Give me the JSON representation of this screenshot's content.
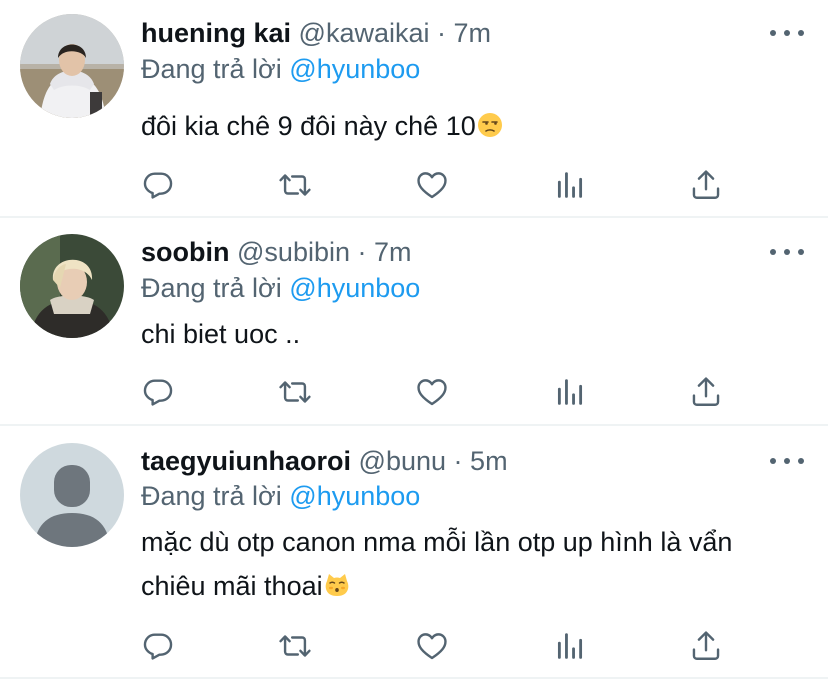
{
  "tweets": [
    {
      "name": "huening kai",
      "handle": "@kawaikai",
      "dot": "·",
      "time": "7m",
      "reply_prefix": "Đang trả lời",
      "reply_to": "@hyunboo",
      "text_lines": [
        "đôi kia chê 9 đôi này chê 10"
      ],
      "emoji": "unamused-face-icon",
      "avatar": "photo-avatar-hoodie"
    },
    {
      "name": "soobin",
      "handle": "@subibin",
      "dot": "·",
      "time": "7m",
      "reply_prefix": "Đang trả lời",
      "reply_to": "@hyunboo",
      "text_lines": [
        "chi biet uoc .."
      ],
      "avatar": "photo-avatar-blond"
    },
    {
      "name": "taegyuiunhaoroi",
      "handle": "@bunu",
      "dot": "·",
      "time": "5m",
      "reply_prefix": "Đang trả lời",
      "reply_to": "@hyunboo",
      "text_lines": [
        "mặc dù otp canon nma mỗi lần otp up hình là vẩn",
        "chiêu mãi thoai"
      ],
      "emoji": "kissing-cat-icon",
      "avatar": "default-avatar"
    }
  ],
  "action_icons": [
    "reply-icon",
    "retweet-icon",
    "like-icon",
    "analytics-icon",
    "share-icon"
  ],
  "colors": {
    "text": "#0f1419",
    "secondary": "#536471",
    "accent": "#1d9bf0",
    "divider": "#eff3f4"
  }
}
